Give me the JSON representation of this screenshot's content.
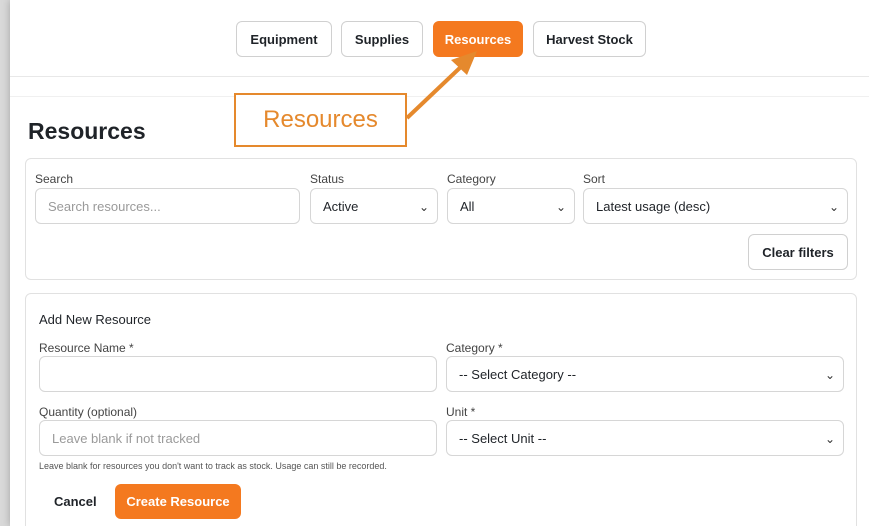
{
  "tabs": [
    {
      "label": "Equipment",
      "active": false
    },
    {
      "label": "Supplies",
      "active": false
    },
    {
      "label": "Resources",
      "active": true
    },
    {
      "label": "Harvest Stock",
      "active": false
    }
  ],
  "callout": {
    "label": "Resources",
    "color": "#e5892d"
  },
  "page": {
    "title": "Resources"
  },
  "filters": {
    "search_label": "Search",
    "search_placeholder": "Search resources...",
    "status_label": "Status",
    "status_value": "Active",
    "category_label": "Category",
    "category_value": "All",
    "sort_label": "Sort",
    "sort_value": "Latest usage (desc)",
    "clear_label": "Clear filters"
  },
  "form": {
    "title": "Add New Resource",
    "name_label": "Resource Name *",
    "name_value": "",
    "category_label": "Category *",
    "category_value": "-- Select Category --",
    "quantity_label": "Quantity (optional)",
    "quantity_placeholder": "Leave blank if not tracked",
    "unit_label": "Unit *",
    "unit_value": "-- Select Unit --",
    "help_text": "Leave blank for resources you don't want to track as stock. Usage can still be recorded.",
    "cancel_label": "Cancel",
    "submit_label": "Create Resource"
  },
  "colors": {
    "accent": "#f4791f",
    "callout": "#e5892d"
  },
  "icons": {
    "select": "chevron-down-icon"
  }
}
